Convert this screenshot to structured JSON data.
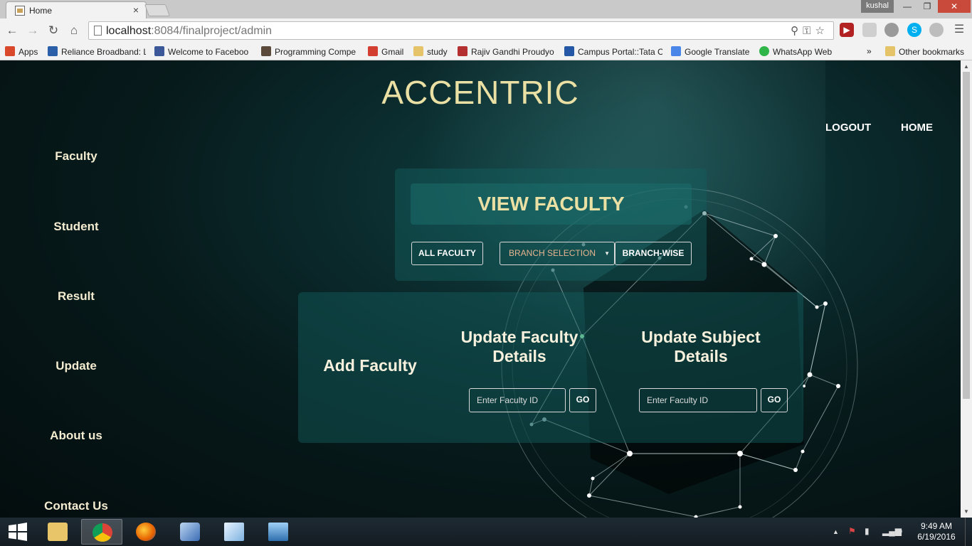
{
  "browser": {
    "tab_title": "Home",
    "tab_close": "×",
    "profile_name": "kushal",
    "url_host": "localhost",
    "url_rest": ":8084/finalproject/admin",
    "bookmarks": [
      {
        "label": "Apps",
        "icon": "apps-icon",
        "color": "#d9482b"
      },
      {
        "label": "Reliance Broadband: L",
        "icon": "reliance-icon",
        "color": "#2b5fa8"
      },
      {
        "label": "Welcome to Faceboo",
        "icon": "facebook-icon",
        "color": "#3b5998"
      },
      {
        "label": "Programming Compe",
        "icon": "codechef-icon",
        "color": "#5b4a3a"
      },
      {
        "label": "Gmail",
        "icon": "gmail-icon",
        "color": "#d23f31"
      },
      {
        "label": "study",
        "icon": "folder-icon",
        "color": "#e5c469"
      },
      {
        "label": "Rajiv Gandhi Proudyo",
        "icon": "rgpv-icon",
        "color": "#b43030"
      },
      {
        "label": "Campus Portal::Tata C",
        "icon": "tata-icon",
        "color": "#2457a6"
      },
      {
        "label": "Google Translate",
        "icon": "translate-icon",
        "color": "#4a86e8"
      },
      {
        "label": "WhatsApp Web",
        "icon": "whatsapp-icon",
        "color": "#2fb548"
      }
    ],
    "bookmarks_overflow": "»",
    "other_bookmarks": "Other bookmarks"
  },
  "site": {
    "brand": "ACCENTRIC",
    "topnav": {
      "logout": "LOGOUT",
      "home": "HOME"
    },
    "sidebar": [
      "Faculty",
      "Student",
      "Result",
      "Update",
      "About us",
      "Contact Us"
    ],
    "view_panel": {
      "title": "VIEW FACULTY",
      "all_button": "ALL FACULTY",
      "branch_select": "BRANCH SELECTION",
      "branch_button": "BRANCH-WISE"
    },
    "actions": {
      "add_faculty": "Add Faculty",
      "update_faculty": "Update Faculty Details",
      "update_subject": "Update Subject Details",
      "faculty_id_placeholder": "Enter Faculty ID",
      "subject_id_placeholder": "Enter Faculty ID",
      "go": "GO"
    },
    "accent_color": "#ebe0a4"
  },
  "taskbar": {
    "apps": [
      "file-explorer-icon",
      "chrome-icon",
      "firefox-icon",
      "virtualbox-icon",
      "notepad-icon",
      "remote-desktop-icon"
    ],
    "time": "9:49 AM",
    "date": "6/19/2016"
  }
}
